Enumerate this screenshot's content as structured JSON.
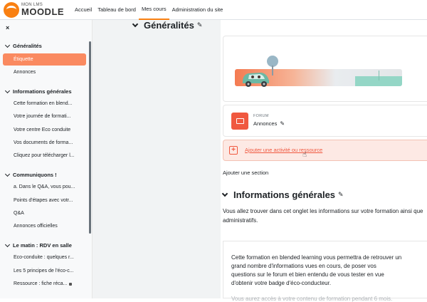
{
  "header": {
    "logo_small": "MON LMS",
    "logo_big": "MOODLE",
    "nav": [
      {
        "label": "Accueil"
      },
      {
        "label": "Tableau de bord"
      },
      {
        "label": "Mes cours"
      },
      {
        "label": "Administration du site"
      }
    ],
    "active_nav": "Mes cours"
  },
  "sidebar": {
    "close_label": "×",
    "sections": [
      {
        "title": "Généralités",
        "items": [
          "Étiquette",
          "Annonces"
        ]
      },
      {
        "title": "Informations générales",
        "items": [
          "Cette formation en blend...",
          "Votre journée de formati...",
          "Votre centre Eco conduite",
          "Vos documents de forma...",
          "Cliquez pour télécharger l..."
        ]
      },
      {
        "title": "Communiquons !",
        "items": [
          "a. Dans le Q&A, vous pou...",
          "Points d'étapes avec votr...",
          "Q&A",
          "Annonces officielles"
        ]
      },
      {
        "title": "Le matin : RDV en salle",
        "items": [
          "Eco-conduite : quelques r...",
          "Les 5 principes de l'éco-c...",
          "Ressource : fiche réca..."
        ]
      }
    ]
  },
  "main": {
    "section1_title": "Généralités",
    "forum_type": "FORUM",
    "forum_name": "Annonces",
    "add_activity": "Ajouter une activité ou ressource",
    "add_section": "Ajouter une section",
    "section2_title": "Informations générales",
    "intro_text": "Vous allez trouver dans cet onglet les informations sur votre formation ainsi que administratifs.",
    "textbox_text": "Cette formation en blended learning vous permettra de retrouver un grand nombre d'informations vues en cours, de poser vos questions sur le forum et bien entendu de vous tester en vue d'obtenir votre badge d'éco-conducteur.",
    "textbox_fade": "Vous aurez accès à votre contenu de formation pendant 6 mois."
  },
  "colors": {
    "accent": "#f98012",
    "active_item": "#fa8a60",
    "forum": "#f0583f",
    "add_bg": "#fde9e4"
  }
}
